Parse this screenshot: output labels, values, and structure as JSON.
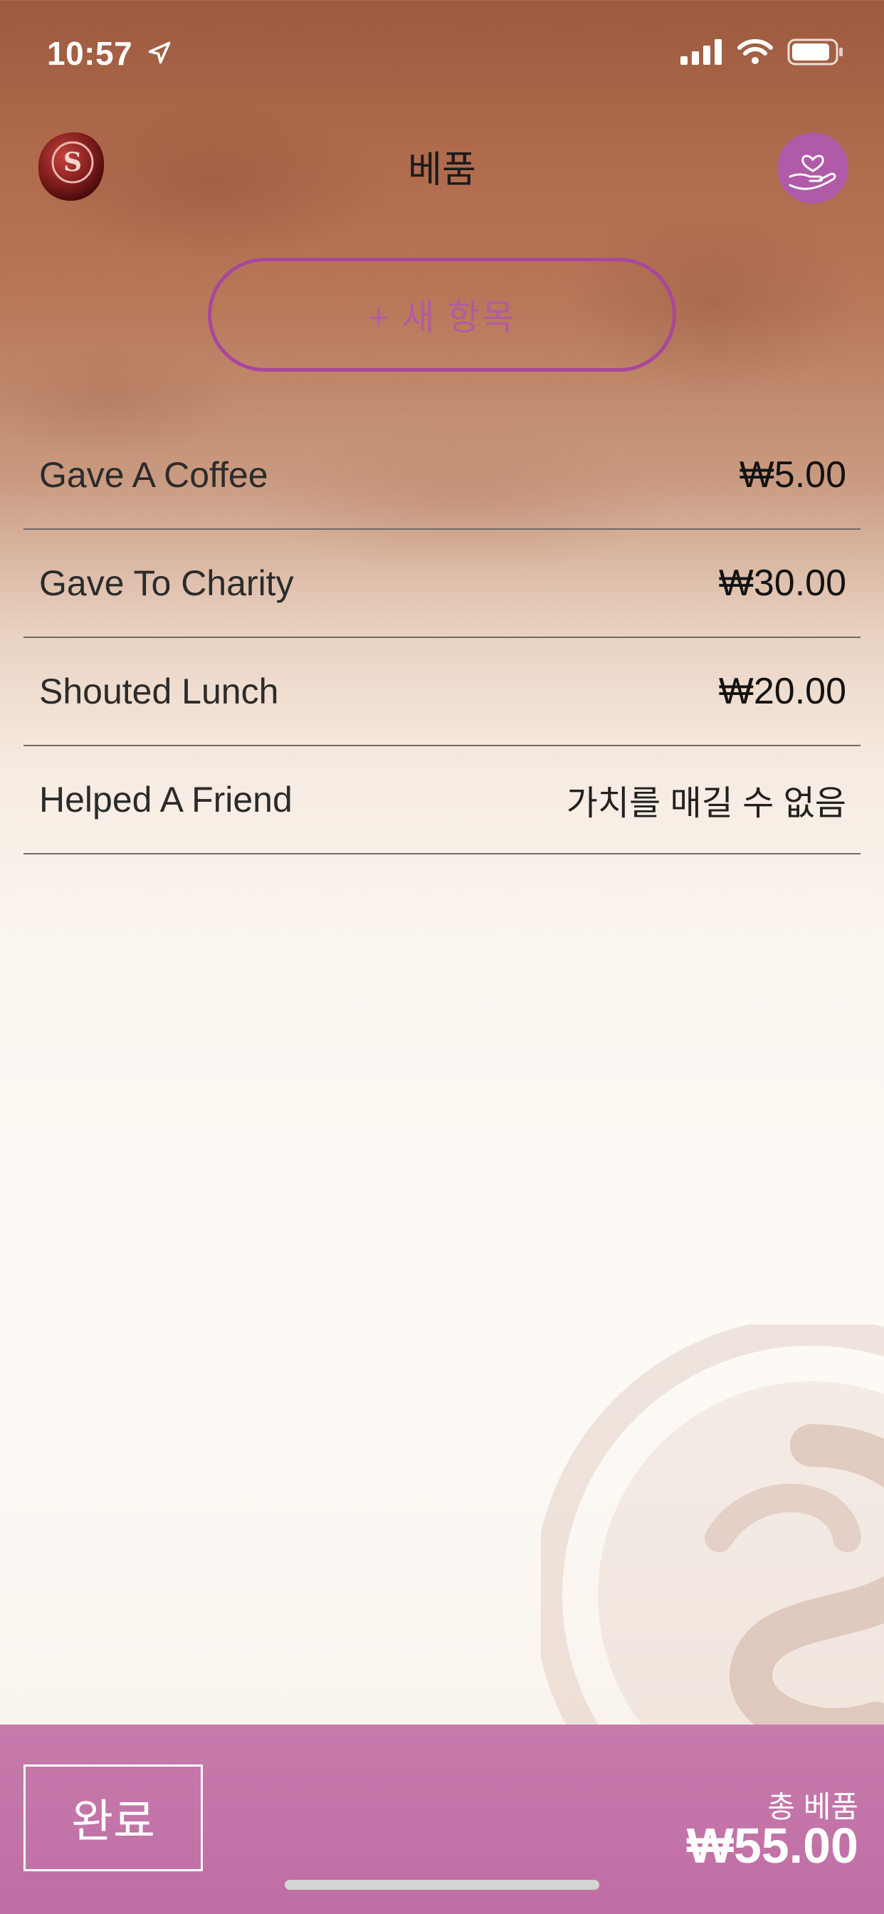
{
  "status_bar": {
    "time": "10:57"
  },
  "header": {
    "title": "베품"
  },
  "actions": {
    "new_item_label": "+ 새 항목"
  },
  "items": [
    {
      "label": "Gave A Coffee",
      "value": "₩5.00"
    },
    {
      "label": "Gave To Charity",
      "value": "₩30.00"
    },
    {
      "label": "Shouted Lunch",
      "value": "₩20.00"
    },
    {
      "label": "Helped A Friend",
      "value": "가치를 매길 수 없음"
    }
  ],
  "footer": {
    "done_label": "완료",
    "total_label": "총 베품",
    "total_value": "₩55.00"
  },
  "colors": {
    "accent": "#a8479e",
    "footer_bg": "#c77aac"
  },
  "icons": [
    "location-arrow-icon",
    "signal-icon",
    "wifi-icon",
    "battery-icon",
    "secret-seal-logo",
    "heart-hand-icon"
  ]
}
